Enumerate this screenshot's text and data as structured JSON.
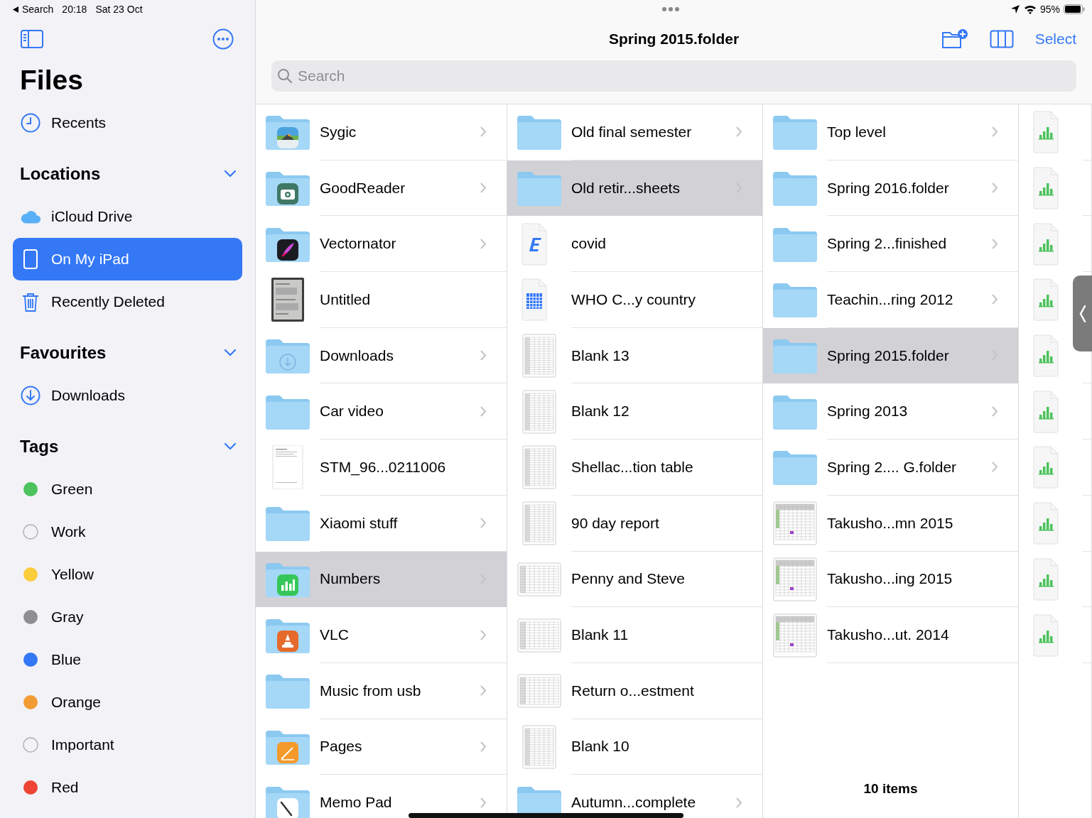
{
  "status_bar": {
    "back_label": "Search",
    "time": "20:18",
    "date": "Sat 23 Oct",
    "battery": "95%"
  },
  "sidebar": {
    "title": "Files",
    "recents": {
      "label": "Recents",
      "kind": "clock",
      "selected": false
    },
    "sections": [
      {
        "title": "Locations",
        "expanded": true,
        "items": [
          {
            "label": "iCloud Drive",
            "kind": "cloud",
            "selected": false
          },
          {
            "label": "On My iPad",
            "kind": "ipad",
            "selected": true
          },
          {
            "label": "Recently Deleted",
            "kind": "trash",
            "selected": false
          }
        ]
      },
      {
        "title": "Favourites",
        "expanded": true,
        "items": [
          {
            "label": "Downloads",
            "kind": "download",
            "selected": false
          }
        ]
      },
      {
        "title": "Tags",
        "expanded": true,
        "items": [
          {
            "label": "Green",
            "kind": "dot",
            "color": "#4cc35c"
          },
          {
            "label": "Work",
            "kind": "ring"
          },
          {
            "label": "Yellow",
            "kind": "dot",
            "color": "#fbcc3b"
          },
          {
            "label": "Gray",
            "kind": "dot",
            "color": "#8e8e93"
          },
          {
            "label": "Blue",
            "kind": "dot",
            "color": "#3478f6"
          },
          {
            "label": "Orange",
            "kind": "dot",
            "color": "#f39b34"
          },
          {
            "label": "Important",
            "kind": "ring"
          },
          {
            "label": "Red",
            "kind": "dot",
            "color": "#ee4435"
          }
        ]
      }
    ]
  },
  "navigation": {
    "title": "Spring 2015.folder",
    "select_label": "Select",
    "search": {
      "placeholder": "Search"
    }
  },
  "columns": [
    {
      "items": [
        {
          "name": "Sygic",
          "kind": "sygic",
          "selected": false
        },
        {
          "name": "GoodReader",
          "kind": "goodreader",
          "selected": false
        },
        {
          "name": "Vectornator",
          "kind": "vectornator",
          "selected": false
        },
        {
          "name": "Untitled",
          "selected": false
        },
        {
          "name": "Downloads",
          "kind": "downloads",
          "selected": false
        },
        {
          "name": "Car video",
          "kind": "folder",
          "selected": false
        },
        {
          "name": "STM_96...0211006",
          "kind": "scan",
          "selected": false
        },
        {
          "name": "Xiaomi stuff",
          "kind": "folder",
          "selected": false
        },
        {
          "name": "Numbers",
          "kind": "numbersapp",
          "selected": true
        },
        {
          "name": "VLC",
          "kind": "vlc",
          "selected": false
        },
        {
          "name": "Music from usb",
          "kind": "folder",
          "selected": false
        },
        {
          "name": "Pages",
          "kind": "pages",
          "selected": false
        },
        {
          "name": "Memo Pad",
          "kind": "memo",
          "selected": false
        }
      ]
    },
    {
      "items": [
        {
          "name": "Old final semester",
          "kind": "folder",
          "selected": false
        },
        {
          "name": "Old retir...sheets",
          "kind": "folder",
          "selected": true
        },
        {
          "name": "covid",
          "kind": "text",
          "selected": false
        },
        {
          "name": "WHO C...y country",
          "kind": "table",
          "selected": false
        },
        {
          "name": "Blank 13",
          "kind": "sheet",
          "selected": false
        },
        {
          "name": "Blank 12",
          "kind": "sheet",
          "selected": false
        },
        {
          "name": "Shellac...tion table",
          "kind": "sheet",
          "selected": false
        },
        {
          "name": "90 day report",
          "kind": "sheet",
          "selected": false
        },
        {
          "name": "Penny and Steve",
          "kind": "widesheet",
          "selected": false
        },
        {
          "name": "Blank 11",
          "kind": "widesheet",
          "selected": false
        },
        {
          "name": "Return o...estment",
          "kind": "widesheet",
          "selected": false
        },
        {
          "name": "Blank 10",
          "kind": "sheet",
          "selected": false
        },
        {
          "name": "Autumn...complete",
          "kind": "folder",
          "selected": false
        }
      ]
    },
    {
      "items": [
        {
          "name": "Top level",
          "kind": "folder",
          "selected": false
        },
        {
          "name": "Spring 2016.folder",
          "kind": "folder",
          "selected": false
        },
        {
          "name": "Spring 2...finished",
          "kind": "folder",
          "selected": false
        },
        {
          "name": "Teachin...ring 2012",
          "kind": "folder",
          "selected": false
        },
        {
          "name": "Spring 2015.folder",
          "kind": "folder",
          "selected": true
        },
        {
          "name": "Spring 2013",
          "kind": "folder",
          "selected": false
        },
        {
          "name": "Spring 2.... G.folder",
          "kind": "folder",
          "selected": false
        },
        {
          "name": "Takusho...mn 2015",
          "kind": "colorsheet",
          "selected": false
        },
        {
          "name": "Takusho...ing 2015",
          "kind": "colorsheet",
          "selected": false
        },
        {
          "name": "Takusho...ut. 2014",
          "kind": "colorsheet",
          "selected": false
        }
      ],
      "footer": "10 items"
    },
    {
      "items": [
        {
          "kind": "numbers"
        },
        {
          "kind": "numbers"
        },
        {
          "kind": "numbers"
        },
        {
          "kind": "numbers"
        },
        {
          "kind": "numbers"
        },
        {
          "kind": "numbers"
        },
        {
          "kind": "numbers"
        },
        {
          "kind": "numbers"
        },
        {
          "kind": "numbers"
        },
        {
          "kind": "numbers"
        }
      ]
    }
  ]
}
